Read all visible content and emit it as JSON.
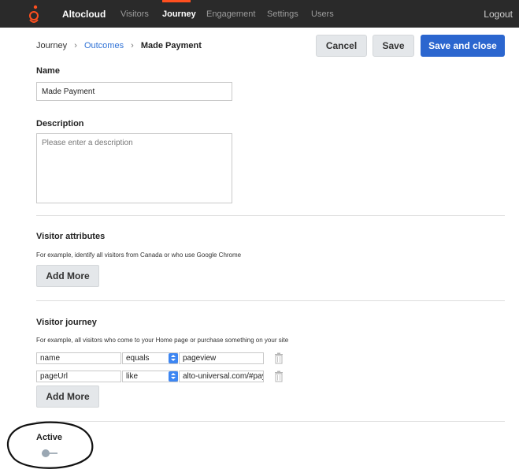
{
  "app": {
    "brand": "Altocloud"
  },
  "nav": {
    "items": [
      "Visitors",
      "Journey",
      "Engagement",
      "Settings",
      "Users"
    ],
    "active": "Journey",
    "logout": "Logout"
  },
  "breadcrumb": {
    "items": [
      "Journey",
      "Outcomes",
      "Made Payment"
    ]
  },
  "actions": {
    "cancel": "Cancel",
    "save": "Save",
    "save_close": "Save and close"
  },
  "form": {
    "name_label": "Name",
    "name_value": "Made Payment",
    "description_label": "Description",
    "description_placeholder": "Please enter a description",
    "visitor_attributes": {
      "title": "Visitor attributes",
      "hint": "For example, identify all visitors from Canada or who use Google Chrome",
      "add_more": "Add More"
    },
    "visitor_journey": {
      "title": "Visitor journey",
      "hint": "For example, all visitors who come to your Home page or purchase something on your site",
      "rows": [
        {
          "field": "name",
          "operator": "equals",
          "value": "pageview"
        },
        {
          "field": "pageUrl",
          "operator": "like",
          "value": "alto-universal.com/#pay"
        }
      ],
      "add_more": "Add More"
    },
    "active_label": "Active"
  },
  "colors": {
    "topbar": "#2a2a2a",
    "accent": "#ff4f1f",
    "primary_button": "#2b66cf",
    "link": "#2f72d6"
  },
  "icons": [
    "altocloud-logo-icon",
    "chevron-right-icon",
    "select-arrows-icon",
    "trash-icon",
    "toggle-icon"
  ]
}
